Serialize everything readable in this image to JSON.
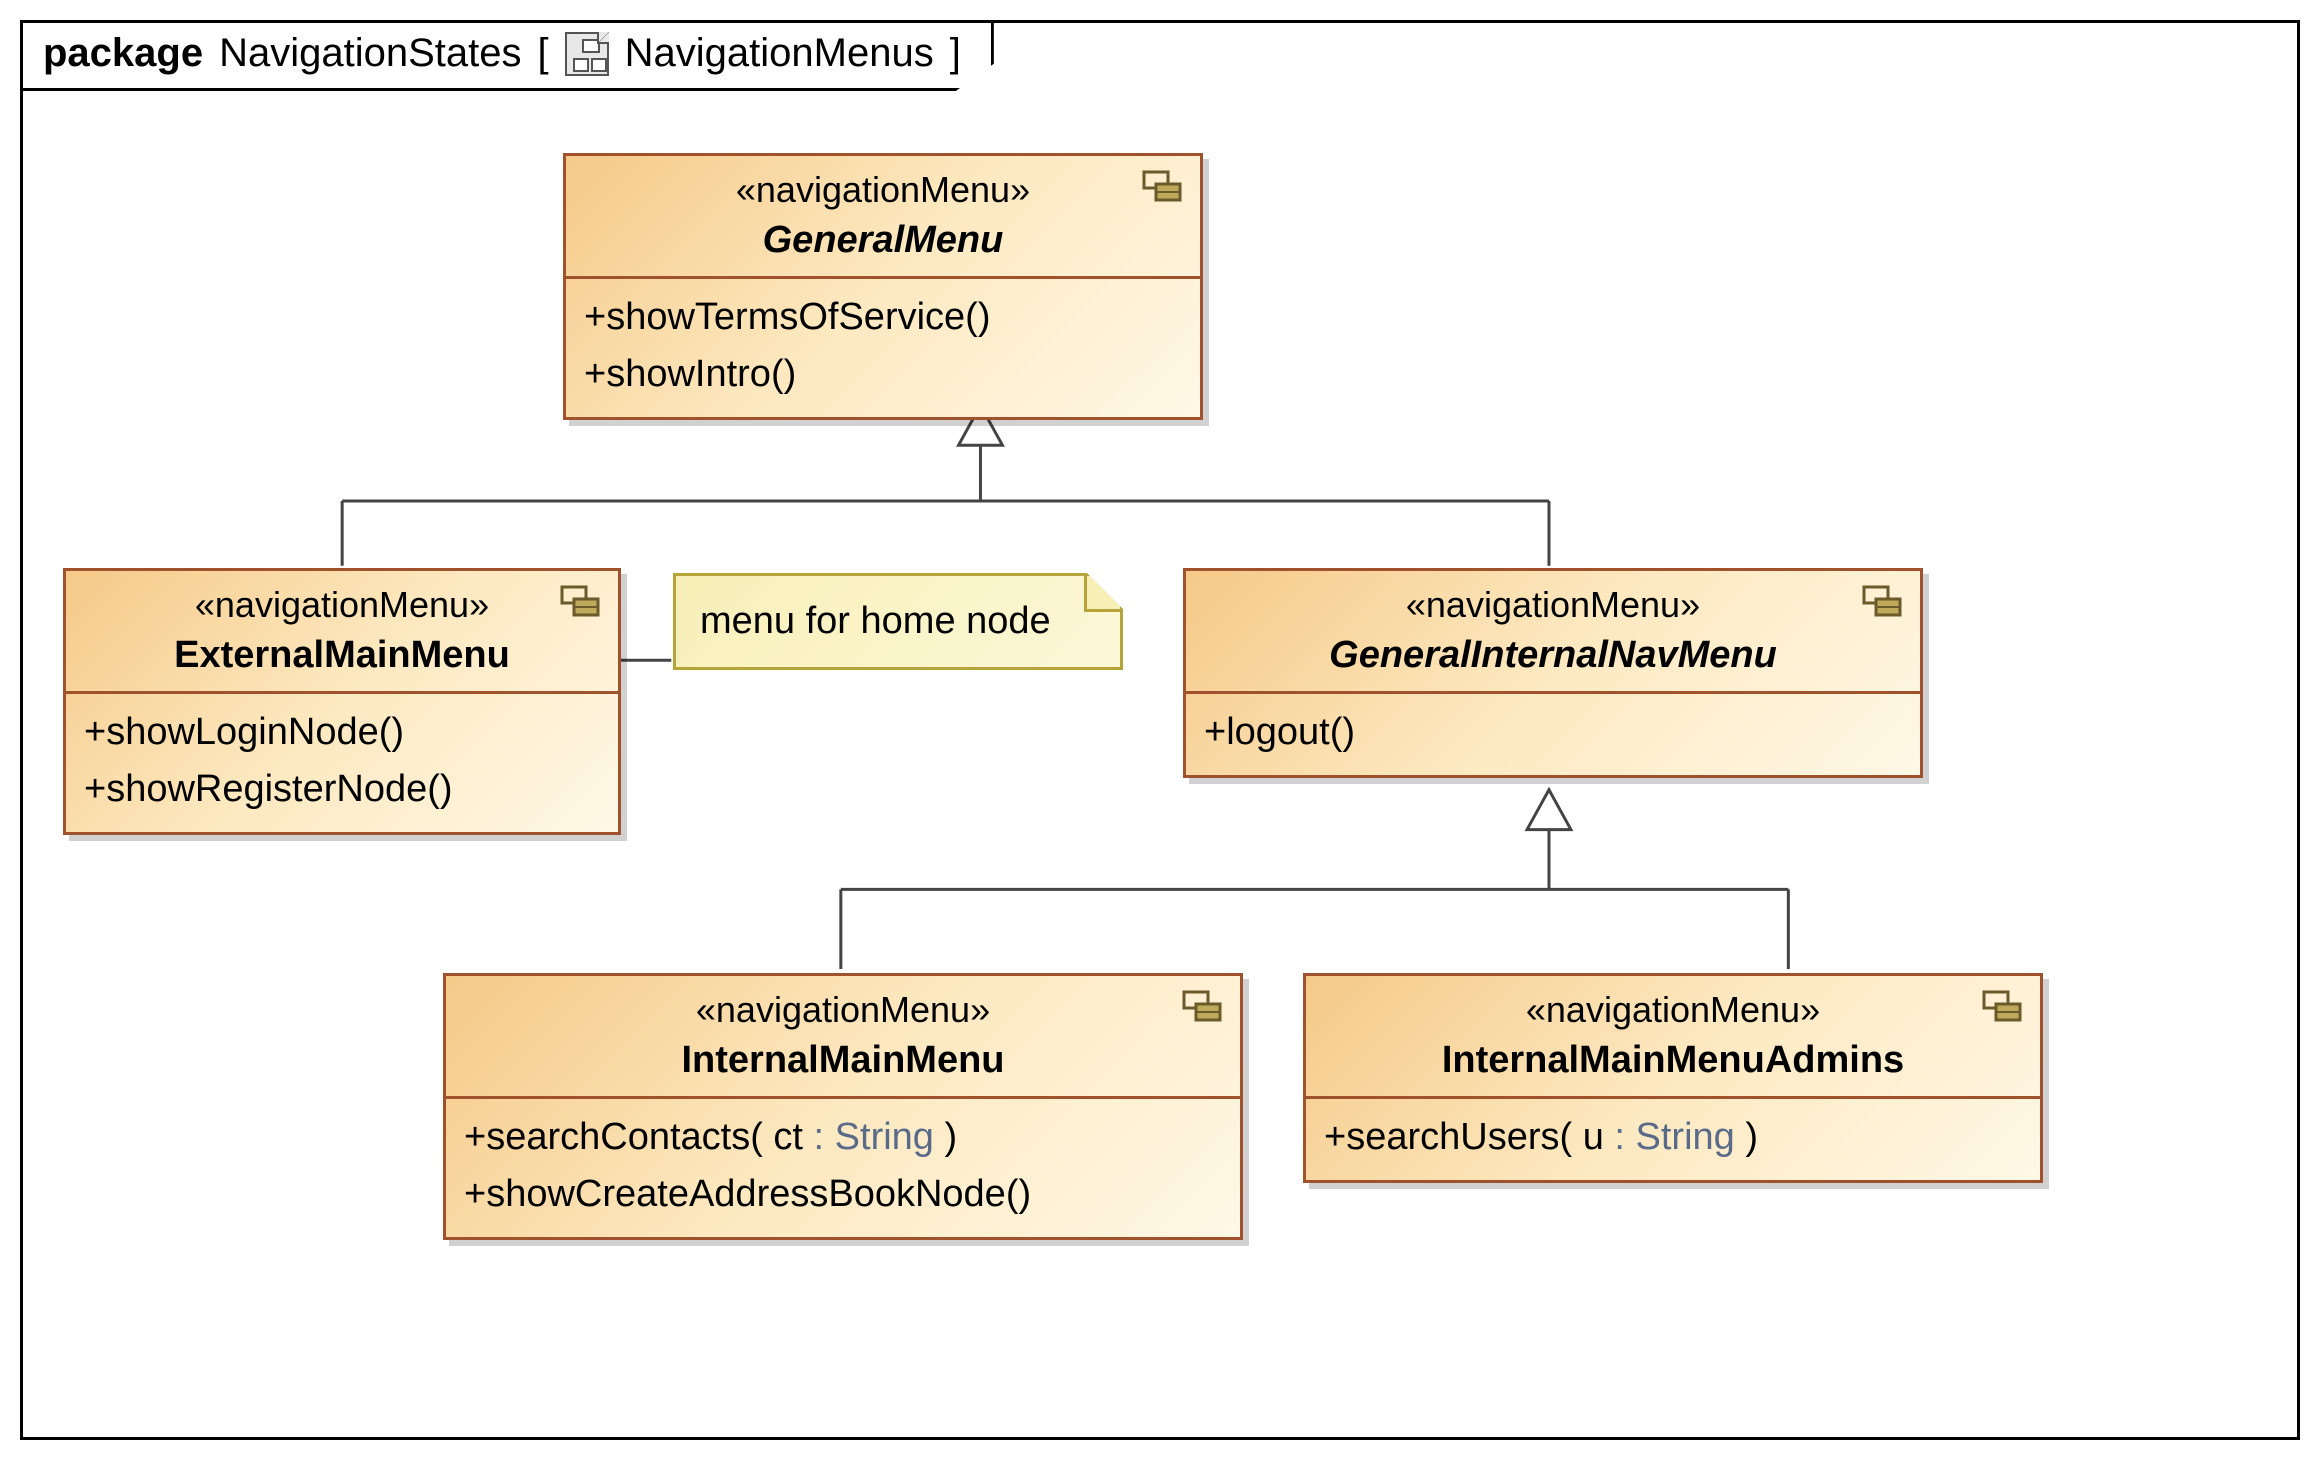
{
  "frame": {
    "keyword": "package",
    "package_name": "NavigationStates",
    "diagram_name": "NavigationMenus"
  },
  "classes": {
    "generalMenu": {
      "stereotype": "«navigationMenu»",
      "name": "GeneralMenu",
      "abstract": true,
      "ops": [
        "+showTermsOfService()",
        "+showIntro()"
      ]
    },
    "externalMainMenu": {
      "stereotype": "«navigationMenu»",
      "name": "ExternalMainMenu",
      "abstract": false,
      "ops": [
        "+showLoginNode()",
        "+showRegisterNode()"
      ]
    },
    "generalInternalNavMenu": {
      "stereotype": "«navigationMenu»",
      "name": "GeneralInternalNavMenu",
      "abstract": true,
      "ops": [
        "+logout()"
      ]
    },
    "internalMainMenu": {
      "stereotype": "«navigationMenu»",
      "name": "InternalMainMenu",
      "abstract": false,
      "ops_html": [
        {
          "pre": "+searchContacts( ct ",
          "type": ": String",
          "post": " )"
        },
        {
          "pre": "+showCreateAddressBookNode()",
          "type": "",
          "post": ""
        }
      ]
    },
    "internalMainMenuAdmins": {
      "stereotype": "«navigationMenu»",
      "name": "InternalMainMenuAdmins",
      "abstract": false,
      "ops_html": [
        {
          "pre": "+searchUsers( u ",
          "type": ": String",
          "post": " )"
        }
      ]
    }
  },
  "note": {
    "text": "menu for home node"
  },
  "chart_data": {
    "type": "uml_class_diagram",
    "title": "NavigationMenus",
    "package": "NavigationStates",
    "nodes": [
      {
        "id": "GeneralMenu",
        "stereotype": "navigationMenu",
        "abstract": true,
        "ops": [
          "+showTermsOfService()",
          "+showIntro()"
        ]
      },
      {
        "id": "ExternalMainMenu",
        "stereotype": "navigationMenu",
        "abstract": false,
        "ops": [
          "+showLoginNode()",
          "+showRegisterNode()"
        ]
      },
      {
        "id": "GeneralInternalNavMenu",
        "stereotype": "navigationMenu",
        "abstract": true,
        "ops": [
          "+logout()"
        ]
      },
      {
        "id": "InternalMainMenu",
        "stereotype": "navigationMenu",
        "abstract": false,
        "ops": [
          "+searchContacts(ct : String)",
          "+showCreateAddressBookNode()"
        ]
      },
      {
        "id": "InternalMainMenuAdmins",
        "stereotype": "navigationMenu",
        "abstract": false,
        "ops": [
          "+searchUsers(u : String)"
        ]
      }
    ],
    "notes": [
      {
        "text": "menu for home node",
        "attached_to": "ExternalMainMenu"
      }
    ],
    "generalizations": [
      {
        "child": "ExternalMainMenu",
        "parent": "GeneralMenu"
      },
      {
        "child": "GeneralInternalNavMenu",
        "parent": "GeneralMenu"
      },
      {
        "child": "InternalMainMenu",
        "parent": "GeneralInternalNavMenu"
      },
      {
        "child": "InternalMainMenuAdmins",
        "parent": "GeneralInternalNavMenu"
      }
    ]
  }
}
